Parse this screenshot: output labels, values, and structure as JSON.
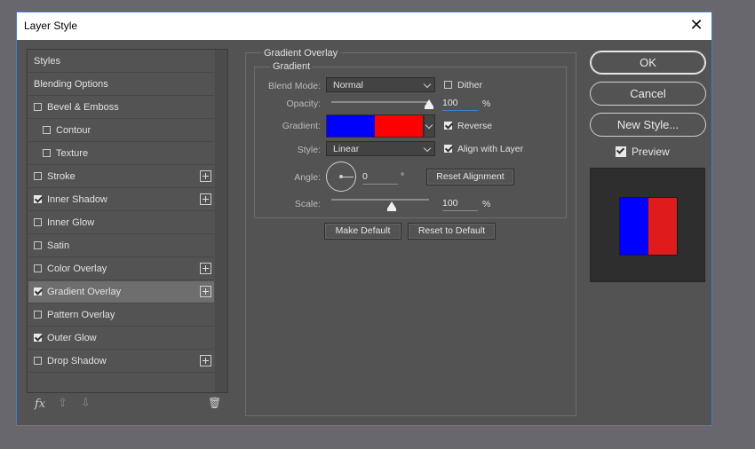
{
  "window": {
    "title": "Layer Style",
    "close_glyph": "✕"
  },
  "styles_list": {
    "items": [
      {
        "label": "Styles",
        "checkbox": null,
        "plus": false,
        "selected": false
      },
      {
        "label": "Blending Options",
        "checkbox": null,
        "plus": false,
        "selected": false
      },
      {
        "label": "Bevel & Emboss",
        "checkbox": false,
        "plus": false,
        "selected": false
      },
      {
        "label": "Contour",
        "checkbox": false,
        "plus": false,
        "selected": false,
        "indent": true
      },
      {
        "label": "Texture",
        "checkbox": false,
        "plus": false,
        "selected": false,
        "indent": true
      },
      {
        "label": "Stroke",
        "checkbox": false,
        "plus": true,
        "selected": false
      },
      {
        "label": "Inner Shadow",
        "checkbox": true,
        "plus": true,
        "selected": false
      },
      {
        "label": "Inner Glow",
        "checkbox": false,
        "plus": false,
        "selected": false
      },
      {
        "label": "Satin",
        "checkbox": false,
        "plus": false,
        "selected": false
      },
      {
        "label": "Color Overlay",
        "checkbox": false,
        "plus": true,
        "selected": false
      },
      {
        "label": "Gradient Overlay",
        "checkbox": true,
        "plus": true,
        "selected": true
      },
      {
        "label": "Pattern Overlay",
        "checkbox": false,
        "plus": false,
        "selected": false
      },
      {
        "label": "Outer Glow",
        "checkbox": true,
        "plus": false,
        "selected": false
      },
      {
        "label": "Drop Shadow",
        "checkbox": false,
        "plus": true,
        "selected": false
      }
    ],
    "bottom": {
      "fx_label": "fx",
      "up_glyph": "⇧",
      "down_glyph": "⇩",
      "trash_glyph": "🗑"
    }
  },
  "gradient_overlay": {
    "group_title": "Gradient Overlay",
    "sub_title": "Gradient",
    "blend_mode": {
      "label": "Blend Mode:",
      "value": "Normal"
    },
    "dither": {
      "label": "Dither",
      "checked": false
    },
    "opacity": {
      "label": "Opacity:",
      "value": "100",
      "unit": "%",
      "level": 1.0
    },
    "gradient": {
      "label": "Gradient:",
      "colors": [
        "#0000ff",
        "#ff0000"
      ],
      "reverse_label": "Reverse",
      "reverse_checked": true
    },
    "style": {
      "label": "Style:",
      "value": "Linear",
      "align_label": "Align with Layer",
      "align_checked": true
    },
    "angle": {
      "label": "Angle:",
      "value": "0",
      "unit": "°",
      "reset_label": "Reset Alignment"
    },
    "scale": {
      "label": "Scale:",
      "value": "100",
      "unit": "%",
      "level": 0.62
    },
    "make_default": "Make Default",
    "reset_default": "Reset to Default"
  },
  "actions": {
    "ok": "OK",
    "cancel": "Cancel",
    "new_style": "New Style...",
    "preview_label": "Preview",
    "preview_checked": true,
    "preview_colors": [
      "#0000ff",
      "#e01b1b"
    ]
  },
  "colors": {
    "accent": "#3d7fd0",
    "panel": "#535353",
    "desktop": "#68676d"
  }
}
